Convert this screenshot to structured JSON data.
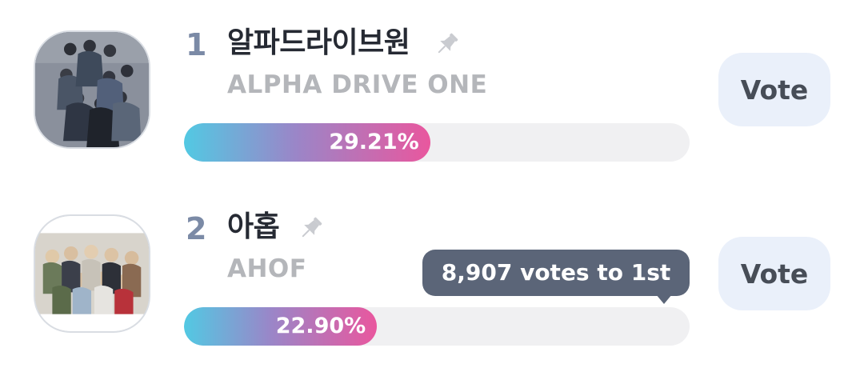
{
  "ranking": [
    {
      "rank": "1",
      "name_kr": "알파드라이브원",
      "name_en": "ALPHA DRIVE ONE",
      "percent_label": "29.21%",
      "percent_value": 29.21,
      "vote_label": "Vote",
      "pin_icon": "pin-icon"
    },
    {
      "rank": "2",
      "name_kr": "아홉",
      "name_en": "AHOF",
      "percent_label": "22.90%",
      "percent_value": 22.9,
      "vote_label": "Vote",
      "pin_icon": "pin-icon",
      "gap_tooltip": "8,907 votes to 1st"
    }
  ],
  "colors": {
    "bar_gradient_start": "#52c9e3",
    "bar_gradient_mid": "#9a86c8",
    "bar_gradient_end": "#e9579e",
    "bar_track": "#f0f0f2",
    "vote_button_bg": "#eaf0fa",
    "tooltip_bg": "#5b6578",
    "rank_color": "#7b8aa6"
  }
}
